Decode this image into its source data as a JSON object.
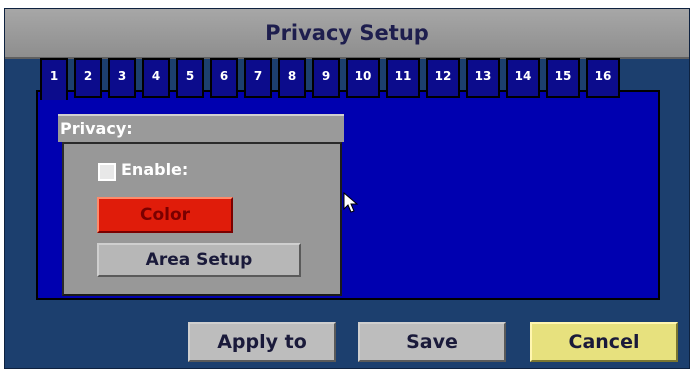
{
  "dialog": {
    "title": "Privacy Setup"
  },
  "tabs": [
    {
      "label": "1",
      "active": true
    },
    {
      "label": "2"
    },
    {
      "label": "3"
    },
    {
      "label": "4"
    },
    {
      "label": "5"
    },
    {
      "label": "6"
    },
    {
      "label": "7"
    },
    {
      "label": "8"
    },
    {
      "label": "9"
    },
    {
      "label": "10"
    },
    {
      "label": "11"
    },
    {
      "label": "12"
    },
    {
      "label": "13"
    },
    {
      "label": "14"
    },
    {
      "label": "15"
    },
    {
      "label": "16"
    }
  ],
  "privacy": {
    "header": "Privacy:",
    "enable_label": "Enable:",
    "enable_checked": false,
    "color_button": "Color",
    "area_setup_button": "Area Setup"
  },
  "footer": {
    "apply_label": "Apply to",
    "save_label": "Save",
    "cancel_label": "Cancel"
  },
  "colors": {
    "dialog_bg": "#1c3f6e",
    "content_bg": "#0000b0",
    "tab_bg": "#0c0c8c",
    "color_swatch": "#e01c0a",
    "cancel_bg": "#e7e17e"
  }
}
